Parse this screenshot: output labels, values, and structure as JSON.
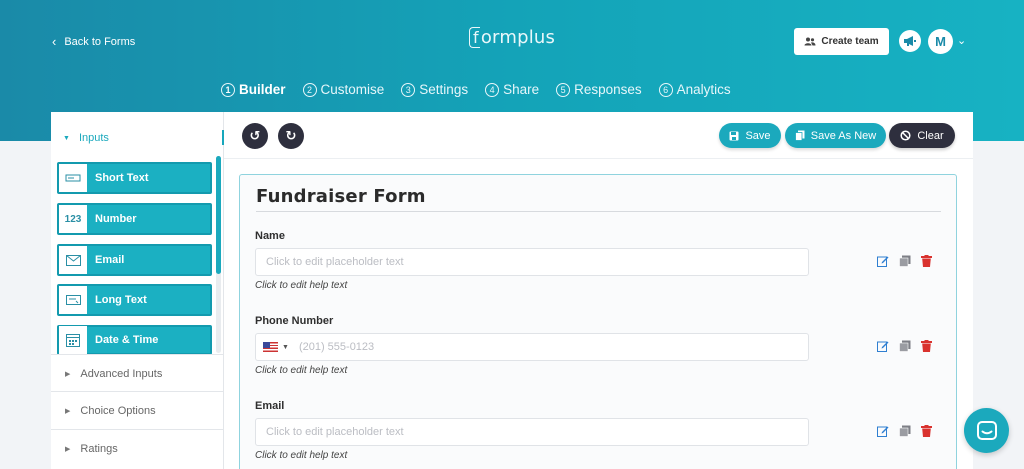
{
  "header": {
    "back_label": "Back to Forms",
    "logo_text": "ormplus",
    "logo_letter": "f",
    "create_team_label": "Create team",
    "avatar_initial": "M"
  },
  "steps": [
    {
      "num": "1",
      "label": "Builder",
      "active": true
    },
    {
      "num": "2",
      "label": "Customise"
    },
    {
      "num": "3",
      "label": "Settings"
    },
    {
      "num": "4",
      "label": "Share"
    },
    {
      "num": "5",
      "label": "Responses"
    },
    {
      "num": "6",
      "label": "Analytics"
    }
  ],
  "sidebar": {
    "section_label": "Inputs",
    "inputs": [
      {
        "label": "Short Text",
        "icon": "short-text-icon"
      },
      {
        "label": "Number",
        "icon_text": "123"
      },
      {
        "label": "Email",
        "icon": "envelope-icon"
      },
      {
        "label": "Long Text",
        "icon": "long-text-icon"
      },
      {
        "label": "Date & Time",
        "icon": "calendar-icon"
      }
    ],
    "categories": [
      "Advanced Inputs",
      "Choice Options",
      "Ratings"
    ]
  },
  "toolbar": {
    "save_label": "Save",
    "save_as_new_label": "Save As New",
    "clear_label": "Clear"
  },
  "form": {
    "title": "Fundraiser Form",
    "fields": [
      {
        "label": "Name",
        "placeholder": "Click to edit placeholder text",
        "help": "Click to edit help text"
      },
      {
        "label": "Phone Number",
        "placeholder": "(201) 555-0123",
        "help": "Click to edit help text"
      },
      {
        "label": "Email",
        "placeholder": "Click to edit placeholder text",
        "help": "Click to edit help text"
      }
    ]
  },
  "colors": {
    "accent": "#1ba9bd",
    "dark": "#2e2f3e",
    "delete": "#d9322e",
    "edit": "#2f7fd1"
  }
}
